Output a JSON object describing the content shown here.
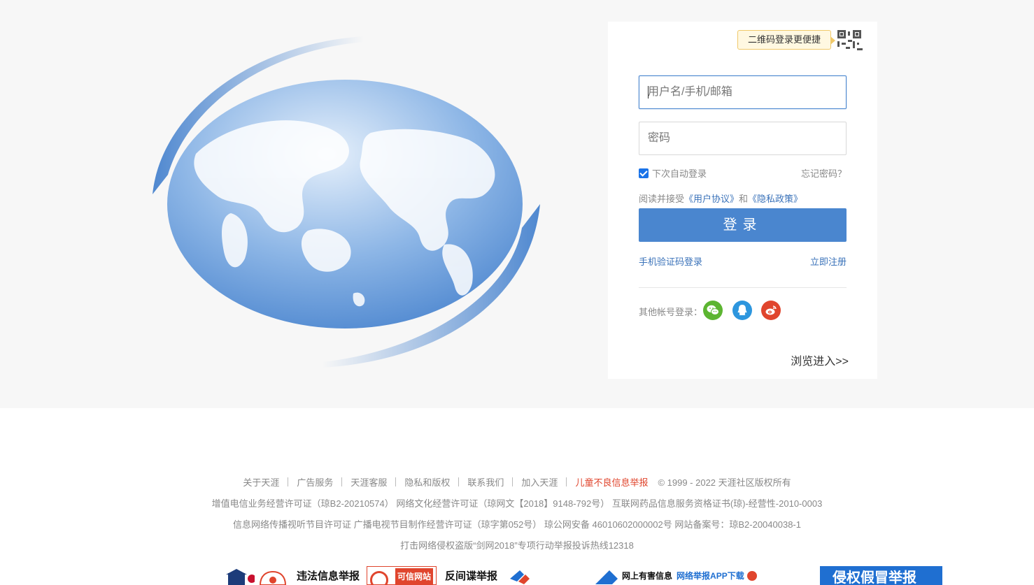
{
  "login": {
    "qr_tip": "二维码登录更便捷",
    "username_placeholder": "用户名/手机/邮箱",
    "password_placeholder": "密码",
    "remember_label": "下次自动登录",
    "forgot_label": "忘记密码？",
    "agree_prefix": "阅读并接受",
    "user_agreement": "《用户协议》",
    "and_text": "和",
    "privacy_policy": "《隐私政策》",
    "login_button": "登录",
    "sms_login": "手机验证码登录",
    "register": "立即注册",
    "other_accounts": "其他帐号登录：",
    "browse": "浏览进入>>"
  },
  "footer": {
    "links": [
      "关于天涯",
      "广告服务",
      "天涯客服",
      "隐私和版权",
      "联系我们",
      "加入天涯"
    ],
    "report_child": "儿童不良信息举报",
    "copyright": "© 1999 - 2022 天涯社区版权所有",
    "line2": "增值电信业务经营许可证（琼B2-20210574） 网络文化经营许可证（琼网文【2018】9148-792号） 互联网药品信息服务资格证书(琼)-经营性-2010-0003",
    "line3": "信息网络传播视听节目许可证   广播电视节目制作经营许可证（琼字第052号） 琼公网安备 46010602000002号  网站备案号：琼B2-20040038-1",
    "line4": "打击网络侵权盗版“剑网2018”专项行动举报投诉热线12318",
    "badges": {
      "illegal_report": "违法信息举报",
      "trusted_site": "可信网站",
      "anti_spy": "反间谍举报",
      "harmful_info": "网上有害信息",
      "app_download": "网络举报APP下载",
      "infringement": "侵权假冒举报"
    }
  },
  "colors": {
    "primary": "#4a86cf",
    "link": "#3a72b9",
    "wechat": "#5cb531",
    "qq": "#2d96de",
    "weibo": "#e0452d"
  }
}
